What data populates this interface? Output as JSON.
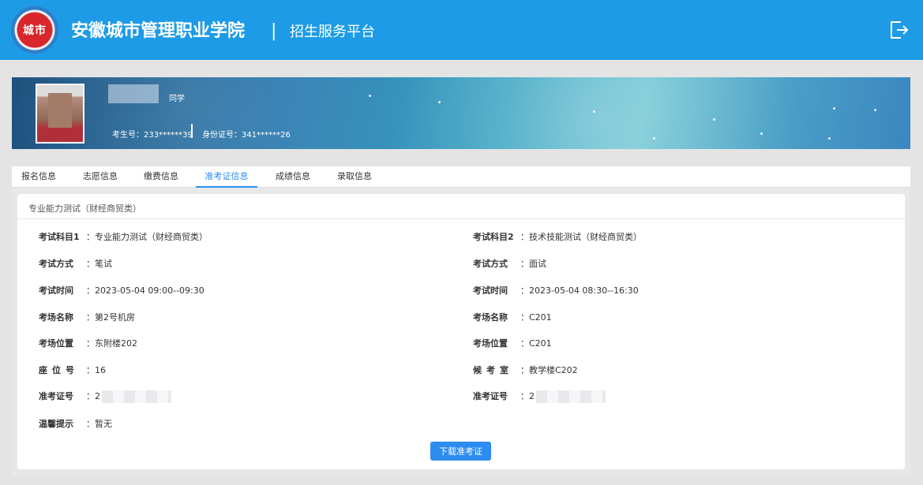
{
  "header": {
    "logo_text": "城市",
    "school_name": "安徽城市管理职业学院",
    "separator": "|",
    "platform_name": "招生服务平台",
    "exit_icon": "logout-icon",
    "bg_color": "#1e9be6"
  },
  "student": {
    "suffix": "同学",
    "exam_no": "考生号：233******39",
    "id_no": "身份证号：341******26"
  },
  "tabs": [
    {
      "label": "报名信息",
      "active": false
    },
    {
      "label": "志愿信息",
      "active": false
    },
    {
      "label": "缴费信息",
      "active": false
    },
    {
      "label": "准考证信息",
      "active": true
    },
    {
      "label": "成绩信息",
      "active": false
    },
    {
      "label": "录取信息",
      "active": false
    }
  ],
  "card": {
    "title": "专业能力测试（财经商贸类）",
    "left": [
      {
        "label": "考试科目1",
        "value": "专业能力测试（财经商贸类）"
      },
      {
        "label": "考试方式",
        "value": "笔试"
      },
      {
        "label": "考试时间",
        "value": "2023-05-04 09:00--09:30"
      },
      {
        "label": "考场名称",
        "value": "第2号机房"
      },
      {
        "label": "考场位置",
        "value": "东附楼202"
      },
      {
        "label": "座位号",
        "value": "16"
      },
      {
        "label": "准考证号",
        "value": "2"
      },
      {
        "label": "温馨提示",
        "value": "暂无"
      }
    ],
    "right": [
      {
        "label": "考试科目2",
        "value": "技术技能测试（财经商贸类）"
      },
      {
        "label": "考试方式",
        "value": "面试"
      },
      {
        "label": "考试时间",
        "value": "2023-05-04 08:30--16:30"
      },
      {
        "label": "考场名称",
        "value": "C201"
      },
      {
        "label": "考场位置",
        "value": "C201"
      },
      {
        "label": "候考室",
        "value": "教学楼C202"
      },
      {
        "label": "准考证号",
        "value": "2"
      }
    ],
    "separator": "：",
    "download_label": "下载准考证"
  },
  "accent_color": "#2d8cf0"
}
